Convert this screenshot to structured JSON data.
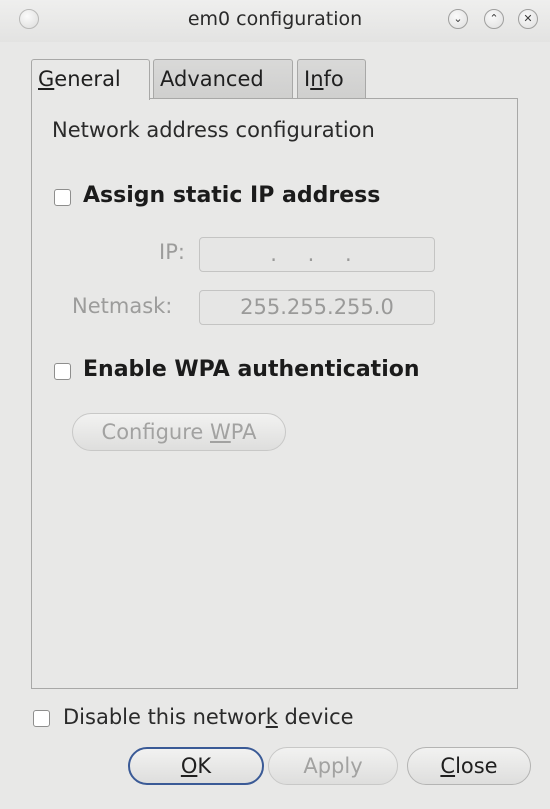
{
  "window": {
    "title": "em0 configuration",
    "controls": [
      "minimize",
      "maximize",
      "close"
    ]
  },
  "tabs": [
    {
      "label_pre": "",
      "mnemonic": "G",
      "label_post": "eneral",
      "active": true
    },
    {
      "label_pre": "",
      "mnemonic": "",
      "label_post": "Advanced",
      "active": false
    },
    {
      "label_pre": "I",
      "mnemonic": "n",
      "label_post": "fo",
      "active": false
    }
  ],
  "general": {
    "section_title": "Network address configuration",
    "static_ip": {
      "label": "Assign static IP address",
      "checked": false,
      "ip_label": "IP:",
      "ip_value": ". . .",
      "netmask_label": "Netmask:",
      "netmask_value": "255.255.255.0"
    },
    "wpa": {
      "label": "Enable WPA authentication",
      "checked": false,
      "configure_pre": "Configure ",
      "configure_mnemonic": "W",
      "configure_post": "PA"
    }
  },
  "footer": {
    "disable_pre": "Disable this networ",
    "disable_mnemonic": "k",
    "disable_post": " device",
    "disable_checked": false,
    "ok_mnemonic": "O",
    "ok_post": "K",
    "apply_label": "Apply",
    "close_mnemonic": "C",
    "close_post": "lose"
  }
}
